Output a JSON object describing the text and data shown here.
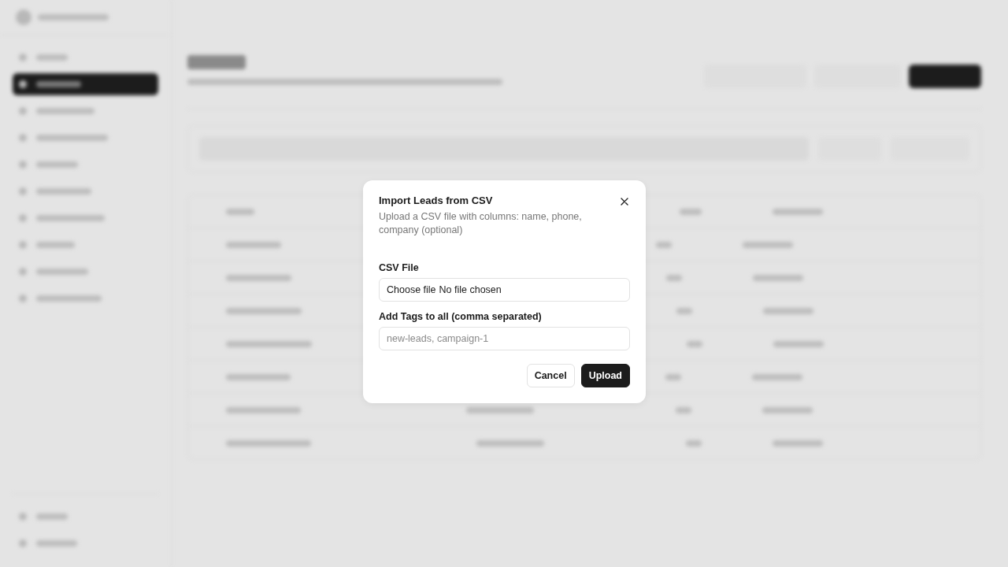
{
  "dialog": {
    "title": "Import Leads from CSV",
    "description": "Upload a CSV file with columns: name, phone, company (optional)",
    "fields": [
      {
        "kind": "file",
        "label": "CSV File",
        "button": "Choose file",
        "value": "No file chosen"
      },
      {
        "kind": "text",
        "label": "Add Tags to all (comma separated)",
        "placeholder": "new-leads, campaign-1"
      }
    ],
    "buttons": [
      {
        "kind": "secondary",
        "label": "Cancel"
      },
      {
        "kind": "primary",
        "label": "Upload"
      }
    ]
  }
}
